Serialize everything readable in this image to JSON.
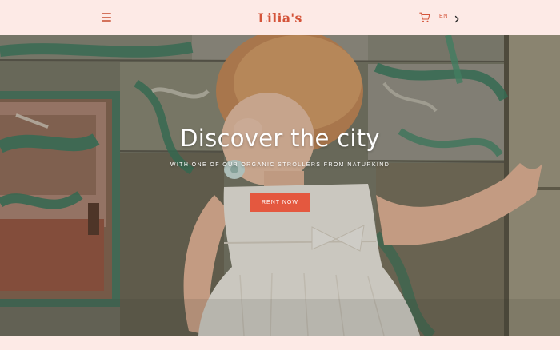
{
  "header": {
    "logo": "Lilia's",
    "language": "EN"
  },
  "hero": {
    "title": "Discover the city",
    "subtitle": "WITH ONE OF OUR ORGANIC STROLLERS FROM NATURKIND",
    "cta_label": "RENT NOW"
  },
  "colors": {
    "background": "#fdeae6",
    "brand": "#d4543a",
    "cta": "#e4583f",
    "text_on_image": "#ffffff"
  },
  "icons": {
    "menu": "hamburger-menu-icon",
    "cart": "shopping-cart-icon",
    "language_arrow": "chevron-right-icon"
  }
}
